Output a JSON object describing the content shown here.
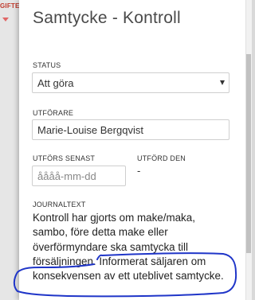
{
  "background": {
    "label": "GIFTE"
  },
  "dialog": {
    "title": "Samtycke - Kontroll",
    "status": {
      "label": "STATUS",
      "value": "Att göra"
    },
    "performer": {
      "label": "UTFÖRARE",
      "value": "Marie-Louise Bergqvist"
    },
    "due": {
      "label": "UTFÖRS SENAST",
      "placeholder": "åååå-mm-dd"
    },
    "done": {
      "label": "UTFÖRD DEN",
      "value": "-"
    },
    "journal": {
      "label": "JOURNALTEXT",
      "lines": [
        "Kontroll har gjorts om make/maka,",
        "sambo, före detta make eller",
        "överförmyndare ska samtycka till",
        "försäljningen. Informerat säljaren om",
        "konsekvensen av ett uteblivet samtycke."
      ]
    }
  },
  "annotation": {
    "color": "#1f35c8"
  }
}
